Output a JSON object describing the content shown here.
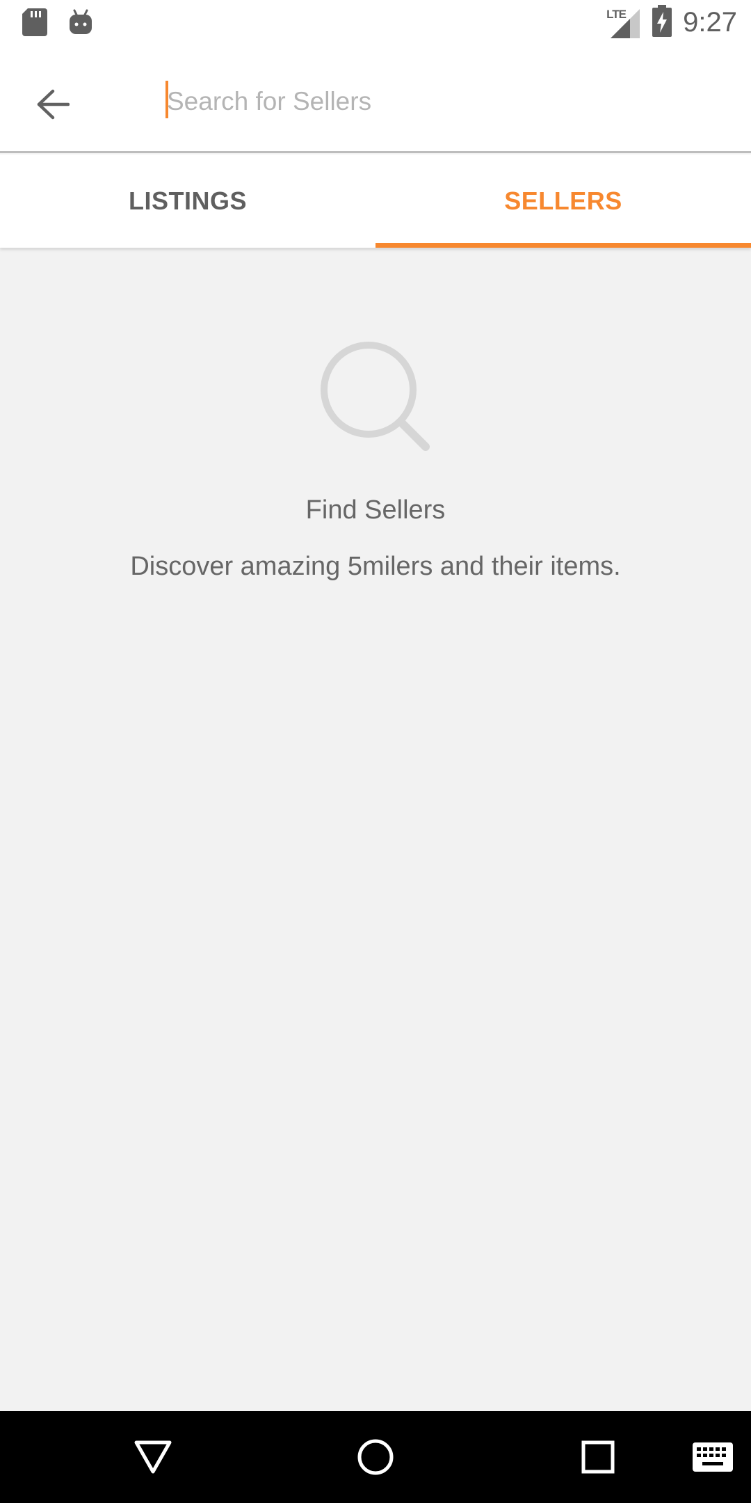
{
  "status_bar": {
    "time": "9:27",
    "network": "LTE",
    "icons": [
      "sd-card-icon",
      "android-icon",
      "signal-icon",
      "battery-charging-icon"
    ]
  },
  "search": {
    "placeholder": "Search for Sellers",
    "value": ""
  },
  "tabs": [
    {
      "label": "LISTINGS",
      "active": false
    },
    {
      "label": "SELLERS",
      "active": true
    }
  ],
  "empty_state": {
    "icon": "search-icon",
    "title": "Find Sellers",
    "subtitle": "Discover amazing 5milers and their items."
  },
  "nav_bar": {
    "icons": [
      "back-triangle-icon",
      "home-circle-icon",
      "recents-square-icon",
      "keyboard-icon"
    ]
  },
  "colors": {
    "accent": "#f7882f",
    "background": "#f2f2f2",
    "text_secondary": "#666666",
    "tab_inactive": "#5f5f5f"
  }
}
